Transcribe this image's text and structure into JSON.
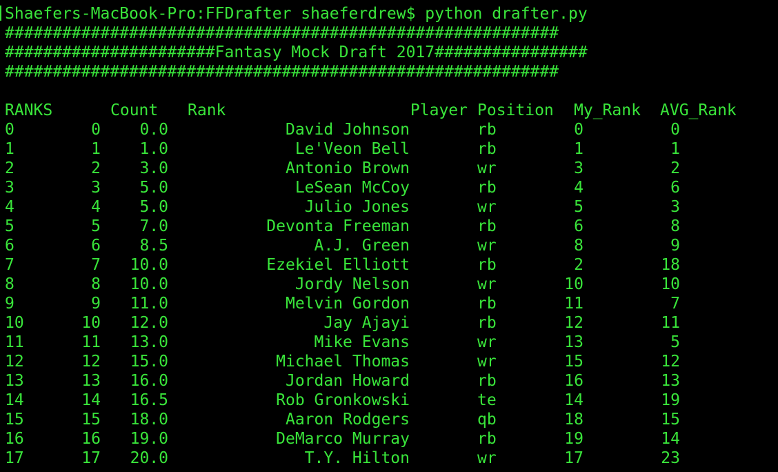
{
  "prompt": {
    "text": "Shaefers-MacBook-Pro:FFDrafter shaeferdrew$ python drafter.py"
  },
  "banner": {
    "line1": "##########################################################",
    "line2": "######################Fantasy Mock Draft 2017################",
    "line3": "##########################################################"
  },
  "table": {
    "headers": {
      "ranks": "RANKS",
      "count": "Count",
      "rank": "Rank",
      "player": "Player",
      "position": "Position",
      "my_rank": "My_Rank",
      "avg_rank": "AVG_Rank"
    },
    "rows": [
      {
        "idx": "0",
        "count": "0",
        "rank": "0.0",
        "player": "David Johnson",
        "position": "rb",
        "my_rank": "0",
        "avg_rank": "0"
      },
      {
        "idx": "1",
        "count": "1",
        "rank": "1.0",
        "player": "Le'Veon Bell",
        "position": "rb",
        "my_rank": "1",
        "avg_rank": "1"
      },
      {
        "idx": "2",
        "count": "2",
        "rank": "3.0",
        "player": "Antonio Brown",
        "position": "wr",
        "my_rank": "3",
        "avg_rank": "2"
      },
      {
        "idx": "3",
        "count": "3",
        "rank": "5.0",
        "player": "LeSean McCoy",
        "position": "rb",
        "my_rank": "4",
        "avg_rank": "6"
      },
      {
        "idx": "4",
        "count": "4",
        "rank": "5.0",
        "player": "Julio Jones",
        "position": "wr",
        "my_rank": "5",
        "avg_rank": "3"
      },
      {
        "idx": "5",
        "count": "5",
        "rank": "7.0",
        "player": "Devonta Freeman",
        "position": "rb",
        "my_rank": "6",
        "avg_rank": "8"
      },
      {
        "idx": "6",
        "count": "6",
        "rank": "8.5",
        "player": "A.J. Green",
        "position": "wr",
        "my_rank": "8",
        "avg_rank": "9"
      },
      {
        "idx": "7",
        "count": "7",
        "rank": "10.0",
        "player": "Ezekiel Elliott",
        "position": "rb",
        "my_rank": "2",
        "avg_rank": "18"
      },
      {
        "idx": "8",
        "count": "8",
        "rank": "10.0",
        "player": "Jordy Nelson",
        "position": "wr",
        "my_rank": "10",
        "avg_rank": "10"
      },
      {
        "idx": "9",
        "count": "9",
        "rank": "11.0",
        "player": "Melvin Gordon",
        "position": "rb",
        "my_rank": "11",
        "avg_rank": "7"
      },
      {
        "idx": "10",
        "count": "10",
        "rank": "12.0",
        "player": "Jay Ajayi",
        "position": "rb",
        "my_rank": "12",
        "avg_rank": "11"
      },
      {
        "idx": "11",
        "count": "11",
        "rank": "13.0",
        "player": "Mike Evans",
        "position": "wr",
        "my_rank": "13",
        "avg_rank": "5"
      },
      {
        "idx": "12",
        "count": "12",
        "rank": "15.0",
        "player": "Michael Thomas",
        "position": "wr",
        "my_rank": "15",
        "avg_rank": "12"
      },
      {
        "idx": "13",
        "count": "13",
        "rank": "16.0",
        "player": "Jordan Howard",
        "position": "rb",
        "my_rank": "16",
        "avg_rank": "13"
      },
      {
        "idx": "14",
        "count": "14",
        "rank": "16.5",
        "player": "Rob Gronkowski",
        "position": "te",
        "my_rank": "14",
        "avg_rank": "19"
      },
      {
        "idx": "15",
        "count": "15",
        "rank": "18.0",
        "player": "Aaron Rodgers",
        "position": "qb",
        "my_rank": "18",
        "avg_rank": "15"
      },
      {
        "idx": "16",
        "count": "16",
        "rank": "19.0",
        "player": "DeMarco Murray",
        "position": "rb",
        "my_rank": "19",
        "avg_rank": "14"
      },
      {
        "idx": "17",
        "count": "17",
        "rank": "20.0",
        "player": "T.Y. Hilton",
        "position": "wr",
        "my_rank": "17",
        "avg_rank": "23"
      }
    ]
  },
  "colors": {
    "background": "#000000",
    "text": "#39e43a"
  }
}
